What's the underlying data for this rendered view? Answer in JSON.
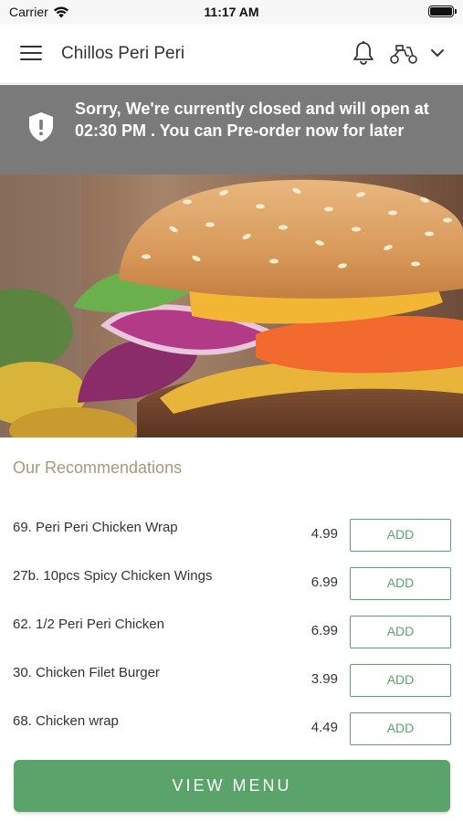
{
  "status_bar": {
    "carrier": "Carrier",
    "time": "11:17 AM"
  },
  "header": {
    "title": "Chillos Peri Peri",
    "icons": [
      "menu-icon",
      "bell-icon",
      "scooter-icon",
      "chevron-down-icon"
    ]
  },
  "banner": {
    "message": "Sorry, We're currently closed and will open at 02:30 PM . You can Pre-order now for later",
    "icon": "shield-alert-icon",
    "background_color": "#7a7a7a"
  },
  "hero": {
    "subject": "burger-photo"
  },
  "recommendations": {
    "title": "Our Recommendations",
    "items": [
      {
        "name": "69. Peri Peri Chicken Wrap",
        "price": "4.99",
        "button": "ADD"
      },
      {
        "name": "27b. 10pcs Spicy Chicken Wings",
        "price": "6.99",
        "button": "ADD"
      },
      {
        "name": "62. 1/2 Peri Peri Chicken",
        "price": "6.99",
        "button": "ADD"
      },
      {
        "name": "30. Chicken Filet Burger",
        "price": "3.99",
        "button": "ADD"
      },
      {
        "name": "68. Chicken wrap",
        "price": "4.49",
        "button": "ADD"
      }
    ]
  },
  "footer": {
    "view_menu_label": "VIEW MENU"
  },
  "colors": {
    "accent": "#5aa46b",
    "recommendations_title": "#a39a79"
  }
}
